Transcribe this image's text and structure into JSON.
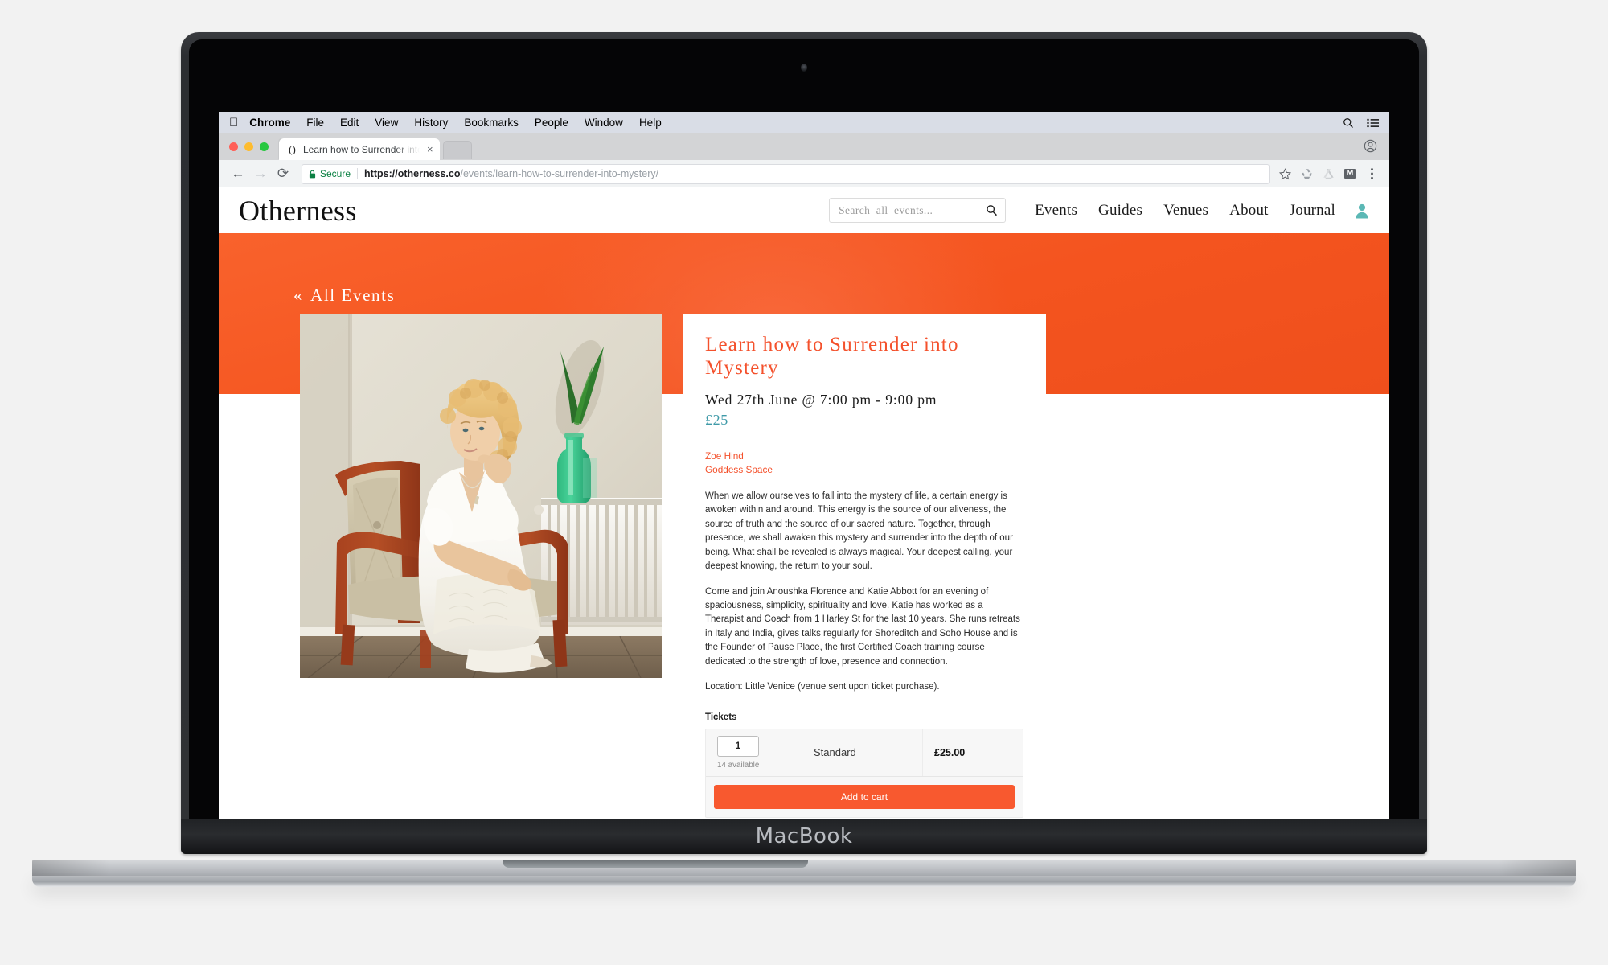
{
  "os": {
    "menubar": {
      "apple_glyph": "apple-logo",
      "items": [
        {
          "label": "Chrome",
          "bold": true
        },
        {
          "label": "File",
          "bold": false
        },
        {
          "label": "Edit",
          "bold": false
        },
        {
          "label": "View",
          "bold": false
        },
        {
          "label": "History",
          "bold": false
        },
        {
          "label": "Bookmarks",
          "bold": false
        },
        {
          "label": "People",
          "bold": false
        },
        {
          "label": "Window",
          "bold": false
        },
        {
          "label": "Help",
          "bold": false
        }
      ],
      "right_icons": [
        "spotlight-search-icon",
        "notification-center-icon"
      ]
    },
    "device_label": "MacBook"
  },
  "browser": {
    "tab": {
      "title": "Learn how to Surrender into Mystery",
      "favicon": "parenthesis-favicon",
      "close_label": "×"
    },
    "new_tab_label": "+",
    "nav": {
      "back": "←",
      "forward": "→",
      "reload": "⟳"
    },
    "omnibox": {
      "secure_label": "Secure",
      "url_host": "https://otherness.co",
      "url_path": "/events/learn-how-to-surrender-into-mystery/",
      "icons": [
        "bookmark-star-icon",
        "recycle-icon",
        "google-drive-icon",
        "gmail-icon",
        "chrome-menu-icon"
      ]
    },
    "profile_icon": "profile-avatar-icon"
  },
  "site": {
    "brand": "Otherness",
    "search": {
      "placeholder": "Search  all  events...",
      "value": "",
      "icon": "search-icon"
    },
    "nav": [
      {
        "label": "Events"
      },
      {
        "label": "Guides"
      },
      {
        "label": "Venues"
      },
      {
        "label": "About"
      },
      {
        "label": "Journal"
      }
    ],
    "account_icon": "account-person-icon"
  },
  "hero": {
    "breadcrumb_chevron": "«",
    "breadcrumb_label": "All  Events",
    "background_color": "#f4541f"
  },
  "event": {
    "image_alt": "woman-in-white-dress-seated-in-wooden-armchair",
    "title": "Learn  how  to  Surrender  into  Mystery",
    "datetime": "Wed  27th  June  @  7:00  pm  -  9:00  pm",
    "price": "£25",
    "price_color": "#3f9aa8",
    "host": "Zoe Hind",
    "venue": "Goddess Space",
    "paragraphs": [
      "When we allow ourselves to fall into the mystery of life, a certain energy is awoken within and around. This energy is the source of our aliveness, the source of truth and the source of our sacred nature. Together, through presence, we shall awaken this mystery and surrender into the depth of our being. What shall be revealed is always magical. Your deepest calling, your deepest knowing, the return to your soul.",
      "Come and join Anoushka Florence and Katie Abbott for an evening of spaciousness, simplicity, spirituality and love. Katie has worked as a Therapist and Coach from 1 Harley St for the last 10 years. She runs retreats in Italy and India, gives talks regularly for Shoreditch and Soho House and is the Founder of Pause Place, the first Certified Coach training course dedicated to the strength of love, presence and connection.",
      "Location: Little Venice (venue sent upon ticket purchase)."
    ]
  },
  "tickets": {
    "heading": "Tickets",
    "rows": [
      {
        "quantity": "1",
        "availability": "14 available",
        "name": "Standard",
        "price": "£25.00"
      }
    ],
    "cart_button_label": "Add to cart",
    "accent_color": "#f8592f"
  }
}
